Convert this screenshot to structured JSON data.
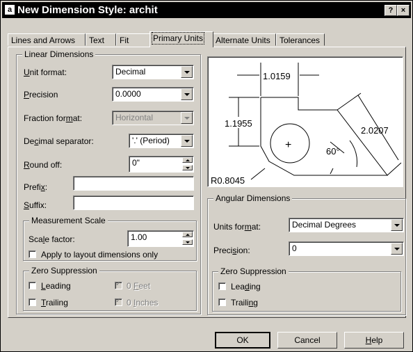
{
  "window": {
    "title": "New Dimension Style: archit",
    "help_glyph": "?",
    "close_glyph": "×",
    "icon": "autocad-app-icon"
  },
  "tabs": [
    {
      "label": "Lines and Arrows"
    },
    {
      "label": "Text"
    },
    {
      "label": "Fit"
    },
    {
      "label": "Primary Units",
      "active": true
    },
    {
      "label": "Alternate Units"
    },
    {
      "label": "Tolerances"
    }
  ],
  "linear": {
    "legend": "Linear Dimensions",
    "unit_format": {
      "pre": "",
      "key": "U",
      "post": "nit format:",
      "value": "Decimal"
    },
    "precision": {
      "pre": "",
      "key": "P",
      "post": "recision",
      "value": "0.0000"
    },
    "fraction_format": {
      "pre": "Fraction for",
      "key": "m",
      "post": "at:",
      "value": "Horizontal"
    },
    "decimal_separator": {
      "pre": "De",
      "key": "c",
      "post": "imal separator:",
      "value": "'.' (Period)"
    },
    "round_off": {
      "pre": "",
      "key": "R",
      "post": "ound off:",
      "value": "0\""
    },
    "prefix": {
      "pre": "Prefi",
      "key": "x",
      "post": ":",
      "value": ""
    },
    "suffix": {
      "pre": "",
      "key": "S",
      "post": "uffix:",
      "value": ""
    }
  },
  "measurement": {
    "legend": "Measurement Scale",
    "scale_factor": {
      "pre": "Sca",
      "key": "l",
      "post": "e factor:",
      "value": "1.00"
    },
    "apply_layout": {
      "label": "Apply to layout dimensions only",
      "checked": false
    }
  },
  "zero_left": {
    "legend": "Zero Suppression",
    "leading": {
      "pre": "",
      "key": "L",
      "post": "eading",
      "checked": false
    },
    "trailing": {
      "pre": "",
      "key": "T",
      "post": "railing",
      "checked": false
    },
    "feet": {
      "pre": "0 ",
      "key": "F",
      "post": "eet",
      "checked": true
    },
    "inches": {
      "pre": "0 ",
      "key": "I",
      "post": "nches",
      "checked": true
    }
  },
  "preview": {
    "dim_top": "1.0159",
    "dim_left": "1.1955",
    "dim_right": "2.0207",
    "angle": "60°",
    "radius": "R0.8045",
    "center_mark": "+"
  },
  "angular": {
    "legend": "Angular Dimensions",
    "units_format": {
      "pre": "Units for",
      "key": "m",
      "post": "at:",
      "value": "Decimal Degrees"
    },
    "precision": {
      "pre": "Preci",
      "key": "s",
      "post": "ion:",
      "value": "0"
    }
  },
  "zero_right": {
    "legend": "Zero Suppression",
    "leading": {
      "pre": "Lea",
      "key": "d",
      "post": "ing",
      "checked": false
    },
    "trailing": {
      "pre": "Traili",
      "key": "n",
      "post": "g",
      "checked": false
    }
  },
  "buttons": {
    "ok": "OK",
    "cancel": "Cancel",
    "help": {
      "pre": "",
      "key": "H",
      "post": "elp"
    }
  }
}
